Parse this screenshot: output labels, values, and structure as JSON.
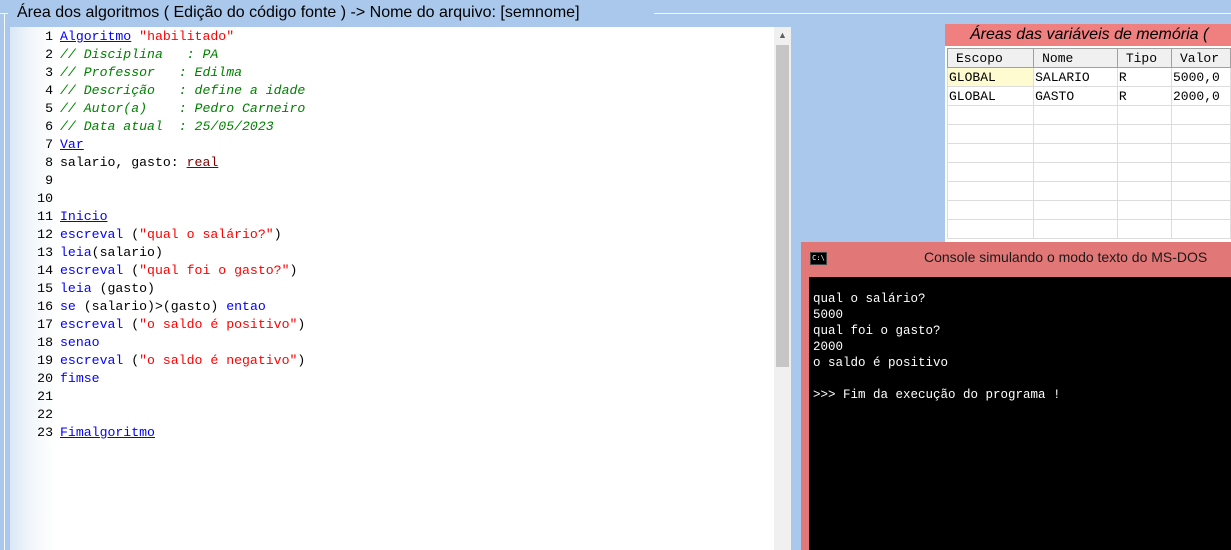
{
  "frame": {
    "title": "Área dos algoritmos ( Edição do código fonte ) -> Nome do arquivo: [semnome]"
  },
  "editor": {
    "lines": [
      {
        "n": "1",
        "parts": [
          {
            "t": "Algoritmo",
            "c": "kw-u"
          },
          {
            "t": " ",
            "c": "plain"
          },
          {
            "t": "\"habilitado\"",
            "c": "str"
          }
        ]
      },
      {
        "n": "2",
        "parts": [
          {
            "t": "// Disciplina   : PA",
            "c": "cmt"
          }
        ]
      },
      {
        "n": "3",
        "parts": [
          {
            "t": "// Professor   : Edilma",
            "c": "cmt"
          }
        ]
      },
      {
        "n": "4",
        "parts": [
          {
            "t": "// Descrição   : define a idade",
            "c": "cmt"
          }
        ]
      },
      {
        "n": "5",
        "parts": [
          {
            "t": "// Autor(a)    : Pedro Carneiro",
            "c": "cmt"
          }
        ]
      },
      {
        "n": "6",
        "parts": [
          {
            "t": "// Data atual  : 25/05/2023",
            "c": "cmt"
          }
        ]
      },
      {
        "n": "7",
        "parts": [
          {
            "t": "Var",
            "c": "kw-u"
          }
        ]
      },
      {
        "n": "8",
        "parts": [
          {
            "t": "salario, gasto: ",
            "c": "plain"
          },
          {
            "t": "real",
            "c": "type"
          }
        ]
      },
      {
        "n": "9",
        "parts": []
      },
      {
        "n": "10",
        "parts": []
      },
      {
        "n": "11",
        "parts": [
          {
            "t": "Inicio",
            "c": "kw-u"
          }
        ]
      },
      {
        "n": "12",
        "parts": [
          {
            "t": "escreval",
            "c": "kw"
          },
          {
            "t": " (",
            "c": "plain"
          },
          {
            "t": "\"qual o salário?\"",
            "c": "str"
          },
          {
            "t": ")",
            "c": "plain"
          }
        ]
      },
      {
        "n": "13",
        "parts": [
          {
            "t": "leia",
            "c": "kw"
          },
          {
            "t": "(salario)",
            "c": "plain"
          }
        ]
      },
      {
        "n": "14",
        "parts": [
          {
            "t": "escreval",
            "c": "kw"
          },
          {
            "t": " (",
            "c": "plain"
          },
          {
            "t": "\"qual foi o gasto?\"",
            "c": "str"
          },
          {
            "t": ")",
            "c": "plain"
          }
        ]
      },
      {
        "n": "15",
        "parts": [
          {
            "t": "leia",
            "c": "kw"
          },
          {
            "t": " (gasto)",
            "c": "plain"
          }
        ]
      },
      {
        "n": "16",
        "parts": [
          {
            "t": "se",
            "c": "kw"
          },
          {
            "t": " (salario)>(gasto) ",
            "c": "plain"
          },
          {
            "t": "entao",
            "c": "kw"
          }
        ]
      },
      {
        "n": "17",
        "parts": [
          {
            "t": "escreval",
            "c": "kw"
          },
          {
            "t": " (",
            "c": "plain"
          },
          {
            "t": "\"o saldo é positivo\"",
            "c": "str"
          },
          {
            "t": ")",
            "c": "plain"
          }
        ]
      },
      {
        "n": "18",
        "parts": [
          {
            "t": "senao",
            "c": "kw"
          }
        ]
      },
      {
        "n": "19",
        "parts": [
          {
            "t": "escreval",
            "c": "kw"
          },
          {
            "t": " (",
            "c": "plain"
          },
          {
            "t": "\"o saldo é negativo\"",
            "c": "str"
          },
          {
            "t": ")",
            "c": "plain"
          }
        ]
      },
      {
        "n": "20",
        "parts": [
          {
            "t": "fimse",
            "c": "kw"
          }
        ]
      },
      {
        "n": "21",
        "parts": []
      },
      {
        "n": "22",
        "parts": []
      },
      {
        "n": "23",
        "parts": [
          {
            "t": "Fimalgoritmo",
            "c": "kw-u"
          }
        ]
      }
    ],
    "scroll_up_icon": "triangle-up-icon"
  },
  "variables": {
    "title": "Áreas das variáveis de memória (",
    "headers": [
      "Escopo",
      "Nome",
      "Tipo",
      "Valor"
    ],
    "rows": [
      [
        "GLOBAL",
        "SALARIO",
        "R",
        "5000,0"
      ],
      [
        "GLOBAL",
        "GASTO",
        "R",
        "2000,0"
      ]
    ],
    "empty_rows": 7
  },
  "console": {
    "title": "Console simulando o modo texto do MS-DOS",
    "icon": "cmd-icon",
    "icon_text": "C:\\",
    "lines": [
      "qual o salário?",
      "5000",
      "qual foi o gasto?",
      "2000",
      "o saldo é positivo",
      "",
      ">>> Fim da execução do programa !"
    ]
  }
}
